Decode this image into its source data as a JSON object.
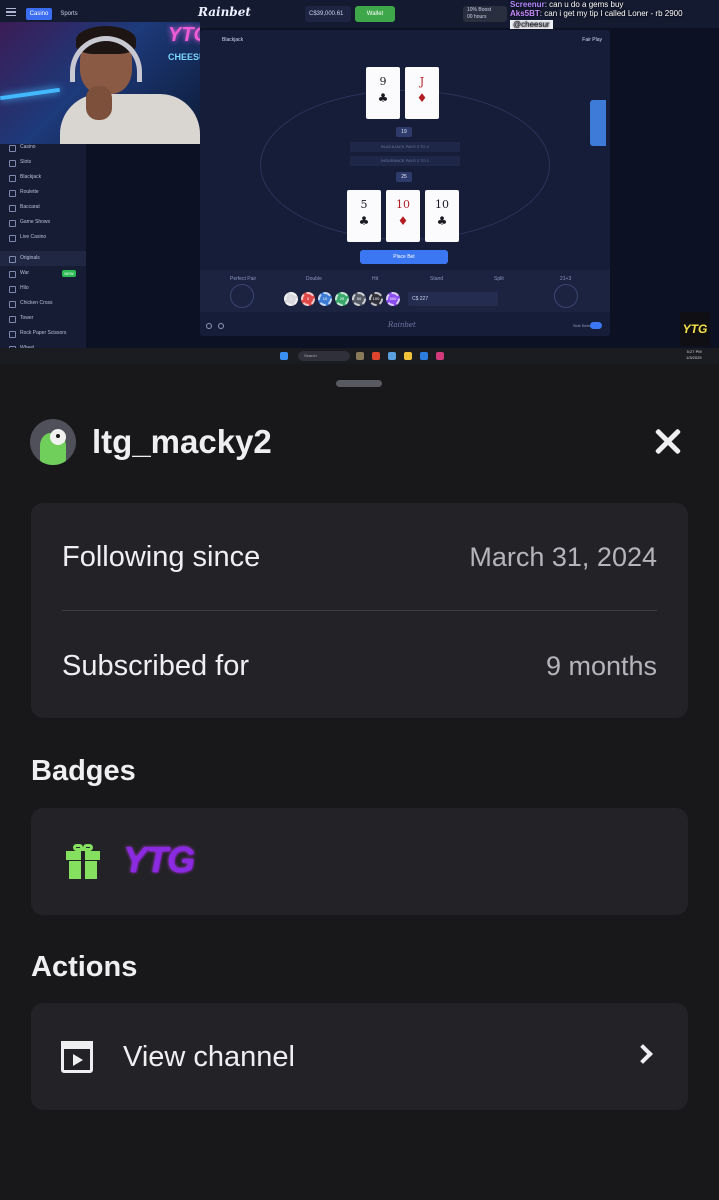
{
  "stream": {
    "topbar": {
      "tab_casino": "Casino",
      "tab_sports": "Sports",
      "brand": "Rainbet",
      "balance": "C$39,000.61",
      "wallet": "Wallet",
      "boost_line1": "10% Boost",
      "boost_line2": "00 hours"
    },
    "cam": {
      "sign_ytg": "YTG",
      "sign_cheesur": "CHEESUR"
    },
    "sidebar": {
      "items": [
        "Casino",
        "Slots",
        "Blackjack",
        "Roulette",
        "Baccarat",
        "Game Shows",
        "Live Casino"
      ],
      "originals_label": "Originals",
      "original_items": [
        "War",
        "Hilo",
        "Chicken Cross",
        "Tower",
        "Rock Paper Scissors",
        "Wheel"
      ],
      "new_tag": "NEW"
    },
    "game": {
      "title": "Blackjack",
      "fair_play": "Fair Play",
      "dealer_cards": [
        {
          "rank": "9",
          "suit": "♣",
          "color": "black"
        },
        {
          "rank": "J",
          "suit": "♦",
          "color": "red"
        }
      ],
      "dealer_score": "19",
      "payout_line1": "BLACKJACK PAYS 3 TO 2",
      "payout_line2": "INSURANCE PAYS 2 TO 1",
      "player_score": "25",
      "player_cards": [
        {
          "rank": "5",
          "suit": "♣",
          "color": "black"
        },
        {
          "rank": "10",
          "suit": "♦",
          "color": "red"
        },
        {
          "rank": "10",
          "suit": "♣",
          "color": "black"
        }
      ],
      "place_bet": "Place Bet",
      "perfect_pair": "Perfect Pair",
      "double": "Double",
      "hit": "Hit",
      "stand": "Stand",
      "split": "Split",
      "twenty_one_plus_three": "21+3",
      "chips": [
        "1",
        "5",
        "10",
        "25",
        "50",
        "100",
        "500"
      ],
      "bet_amount": "C$ 227",
      "brand_footer": "Rainbet",
      "side_bets": "Side Bets"
    },
    "chat": [
      {
        "user": "Screenur",
        "message": "can u do a gems buy"
      },
      {
        "user": "Aks5BT",
        "message": "can i get my tip I called Loner - rb 2900"
      }
    ],
    "mention": "@cheesur",
    "overlay_logo": "YTG",
    "taskbar": {
      "search": "Search",
      "time": "5:27 PM",
      "date": "1/3/2025"
    }
  },
  "profile": {
    "username": "ltg_macky2",
    "following_label": "Following since",
    "following_value": "March 31, 2024",
    "subscribed_label": "Subscribed for",
    "subscribed_value": "9 months",
    "badges_title": "Badges",
    "badges": [
      "gift-icon",
      "YTG"
    ],
    "actions_title": "Actions",
    "view_channel": "View channel"
  },
  "colors": {
    "panel_bg": "#18181b",
    "card_bg": "#232327",
    "badge_green": "#86e05f",
    "badge_purple": "#8a2be2",
    "accent_blue": "#3b77f2"
  }
}
